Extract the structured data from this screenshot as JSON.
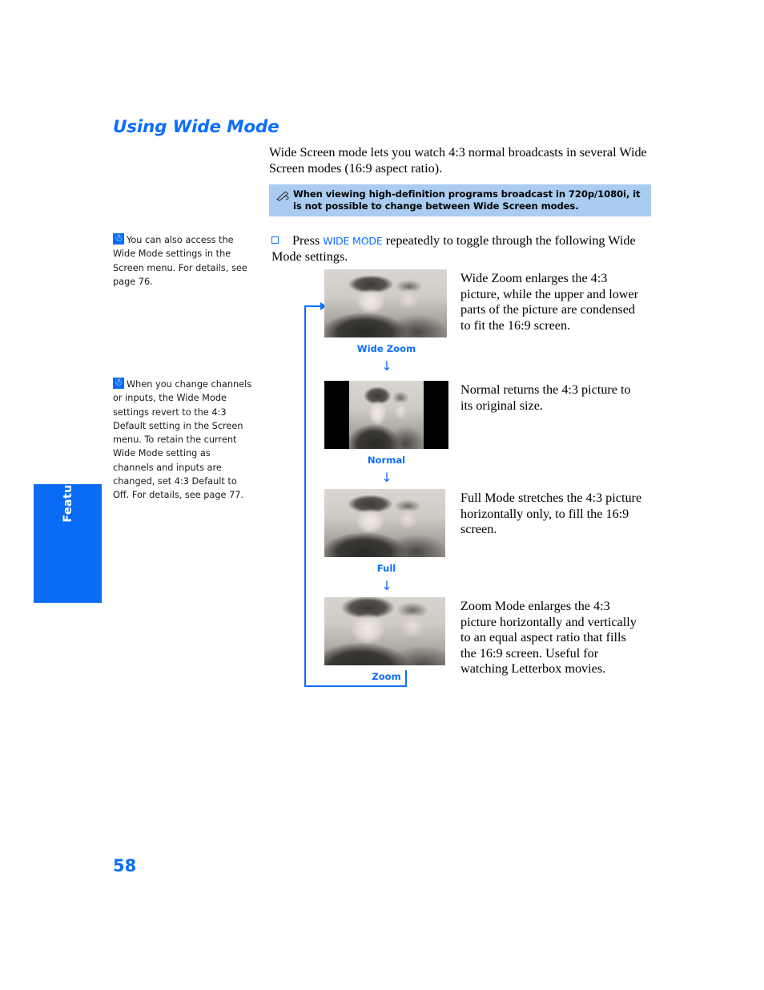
{
  "page": {
    "title": "Using Wide Mode",
    "number": "58",
    "side_tab": "Features",
    "accent_color": "#0d6efd",
    "tab_color": "#0a6cf5",
    "note_bg_color": "#aaccf0"
  },
  "intro": {
    "paragraph": "Wide Screen mode lets you watch 4:3 normal broadcasts in several Wide Screen modes (16:9 aspect ratio)."
  },
  "note": {
    "icon": "pencil-note-icon",
    "text": "When viewing high-definition programs broadcast in 720p/1080i, it is not possible to change between Wide Screen modes."
  },
  "tips": [
    {
      "icon": "lightbulb-icon",
      "text": "You can also access the Wide Mode settings in the Screen menu. For details, see page 76."
    },
    {
      "icon": "lightbulb-icon",
      "text": "When you change channels or inputs, the Wide Mode settings revert to the 4:3 Default setting in the Screen menu. To retain the current Wide Mode setting as channels and inputs are changed, set 4:3 Default to Off. For details, see page 77."
    }
  ],
  "instruction": {
    "bullet": "checkbox-bullet",
    "prefix": "Press ",
    "keycap": "WIDE MODE",
    "suffix": " repeatedly to toggle through the following Wide Mode settings."
  },
  "modes": [
    {
      "caption": "Wide Zoom",
      "description": "Wide Zoom enlarges the 4:3 picture, while the upper and lower parts of the picture are condensed to fit the 16:9 screen.",
      "thumbnail": "wide-zoom-sample-photo",
      "arrow_after": "↓"
    },
    {
      "caption": "Normal",
      "description": "Normal returns the 4:3 picture to its original size.",
      "thumbnail": "normal-sample-photo-pillarboxed",
      "arrow_after": "↓"
    },
    {
      "caption": "Full",
      "description": "Full Mode stretches the 4:3 picture horizontally only, to fill the 16:9 screen.",
      "thumbnail": "full-sample-photo",
      "arrow_after": "↓"
    },
    {
      "caption": "Zoom",
      "description": "Zoom Mode enlarges the 4:3 picture horizontally and vertically to an equal aspect ratio that fills the 16:9 screen. Useful for watching Letterbox movies.",
      "thumbnail": "zoom-sample-photo",
      "arrow_after": ""
    }
  ]
}
